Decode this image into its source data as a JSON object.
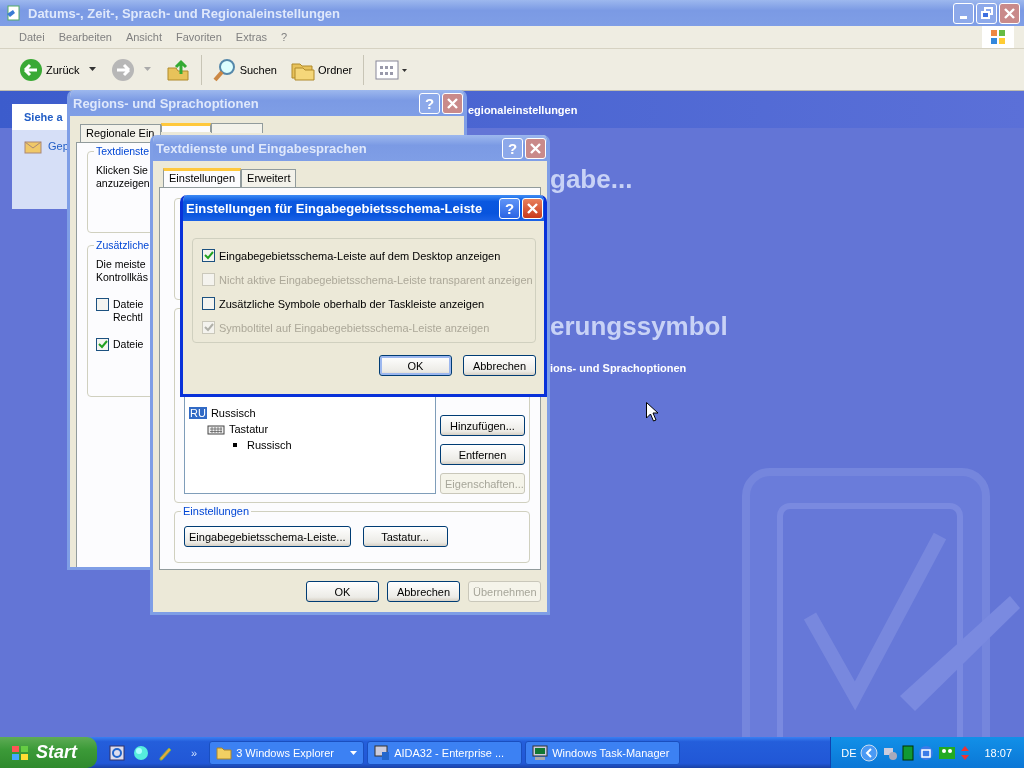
{
  "explorer": {
    "title": "Datums-, Zeit-, Sprach- und Regionaleinstellungen",
    "active": false,
    "menu": [
      "Datei",
      "Bearbeiten",
      "Ansicht",
      "Favoriten",
      "Extras",
      "?"
    ],
    "toolbar": [
      {
        "kind": "back",
        "label": "Zurück"
      },
      {
        "kind": "forward"
      },
      {
        "kind": "up"
      },
      {
        "kind": "search",
        "label": "Suchen"
      },
      {
        "kind": "folders",
        "label": "Ordner"
      },
      {
        "kind": "views"
      }
    ],
    "side_panel": {
      "title": "Siehe a",
      "link": "Gep"
    },
    "header": "egionaleinstellungen",
    "headings": [
      "gabe...",
      "erungssymbol"
    ],
    "link": "ions- und Sprachoptionen"
  },
  "regional_dialog": {
    "title": "Regions- und Sprachoptionen",
    "help": "?",
    "active": false,
    "tabs": [
      {
        "label": "Regionale Ein",
        "selected": false
      },
      {
        "selected": true
      },
      {
        "selected": false
      }
    ],
    "groups": [
      {
        "title": "Textdienste",
        "lines": [
          "Klicken Sie",
          "anzuzeigen"
        ]
      },
      {
        "title": "Zusätzliche",
        "lines": [
          "Die meiste",
          "Kontrollkäs"
        ],
        "options": [
          {
            "lines": [
              "Dateie",
              "Rechtl"
            ],
            "checked": false
          },
          {
            "lines": [
              "Dateie"
            ],
            "checked": true
          }
        ]
      }
    ]
  },
  "text_services_dialog": {
    "title": "Textdienste und Eingabesprachen",
    "help": "?",
    "active": false,
    "tabs": [
      {
        "label": "Einstellungen",
        "selected": true
      },
      {
        "label": "Erweitert",
        "selected": false
      }
    ],
    "tree": [
      {
        "kind": "language",
        "badge": "RU",
        "label": "Russisch",
        "children": [
          {
            "kind": "keyboard",
            "label": "Tastatur",
            "children": [
              {
                "kind": "layout",
                "label": "Russisch"
              }
            ]
          }
        ]
      }
    ],
    "side_buttons": [
      {
        "label": "Hinzufügen...",
        "disabled": false
      },
      {
        "label": "Entfernen",
        "disabled": false
      },
      {
        "label": "Eigenschaften...",
        "disabled": true
      }
    ],
    "settings_group": {
      "title": "Einstellungen",
      "buttons": [
        "Eingabegebietsschema-Leiste...",
        "Tastatur..."
      ]
    },
    "buttons": [
      {
        "label": "OK",
        "disabled": false
      },
      {
        "label": "Abbrechen",
        "disabled": false
      },
      {
        "label": "Übernehmen",
        "disabled": true
      }
    ]
  },
  "language_bar_dialog": {
    "title": "Einstellungen für Eingabegebietsschema-Leiste",
    "help": "?",
    "active": true,
    "options": [
      {
        "label": "Eingabegebietsschema-Leiste auf dem Desktop anzeigen",
        "checked": true,
        "disabled": false
      },
      {
        "label": "Nicht aktive Eingabegebietsschema-Leiste transparent anzeigen",
        "checked": false,
        "disabled": true
      },
      {
        "label": "Zusätzliche Symbole oberhalb der Taskleiste anzeigen",
        "checked": false,
        "disabled": false
      },
      {
        "label": "Symboltitel auf Eingabegebietsschema-Leiste anzeigen",
        "checked": true,
        "disabled": true
      }
    ],
    "buttons": [
      "OK",
      "Abbrechen"
    ]
  },
  "taskbar": {
    "start": "Start",
    "overflow": "»",
    "tasks": [
      {
        "kind": "folder",
        "label": "3 Windows Explorer",
        "grouped": true
      },
      {
        "kind": "info",
        "label": "AIDA32 - Enterprise ...",
        "grouped": false
      },
      {
        "kind": "monitor",
        "label": "Windows Task-Manager",
        "grouped": false
      }
    ],
    "language": "DE",
    "clock": "18:07"
  }
}
